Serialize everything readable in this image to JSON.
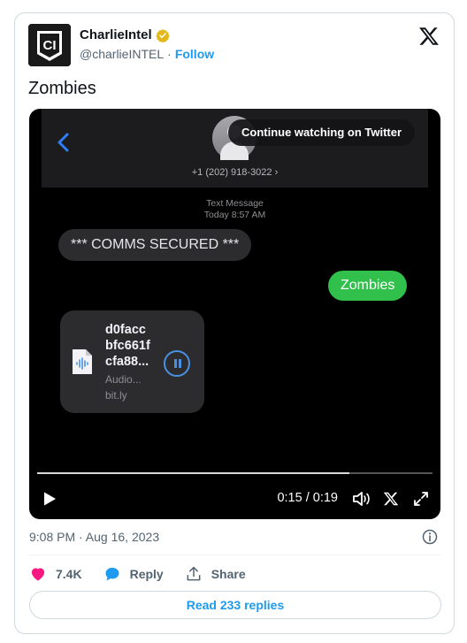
{
  "author": {
    "display_name": "CharlieIntel",
    "handle": "@charlieINTEL",
    "separator": "·",
    "follow_label": "Follow",
    "avatar_text": "CI",
    "icon": "verified-badge-icon"
  },
  "tweet": {
    "text": "Zombies",
    "timestamp": "9:08 PM · Aug 16, 2023"
  },
  "video": {
    "continue_label": "Continue watching on Twitter",
    "phone_number": "+1 (202) 918-3022 ›",
    "meta_line1": "Text Message",
    "meta_line2": "Today 8:57 AM",
    "incoming_message": "*** COMMS SECURED ***",
    "outgoing_message": "Zombies",
    "attachment": {
      "line1": "d0facc",
      "line2": "bfc661f",
      "line3": "cfa88...",
      "type_label": "Audio...",
      "source": "bit.ly"
    },
    "time_display": "0:15 / 0:19",
    "progress_fraction": 0.79
  },
  "actions": {
    "likes": "7.4K",
    "reply_label": "Reply",
    "share_label": "Share"
  },
  "read_replies_label": "Read 233 replies",
  "colors": {
    "accent": "#1d9bf0",
    "like": "#f91880",
    "imessage_green": "#30c04b",
    "verified_gold": "#e2b719"
  }
}
